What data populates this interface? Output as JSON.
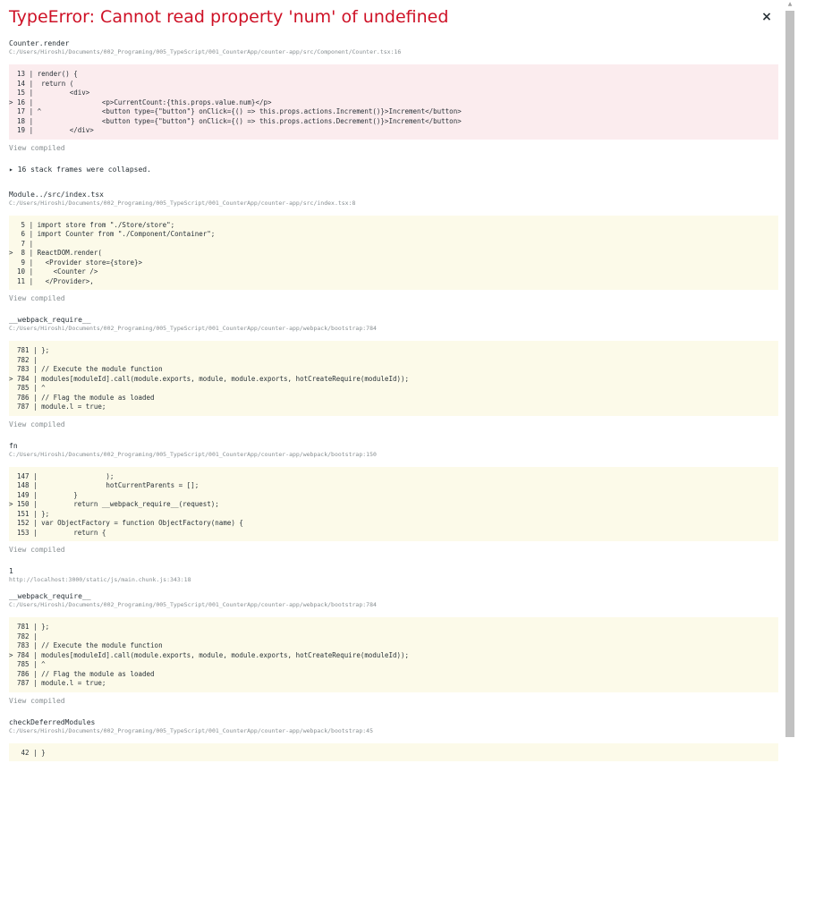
{
  "error": {
    "title": "TypeError: Cannot read property 'num' of undefined",
    "close_icon": "close-icon"
  },
  "view_compiled_label": "View compiled",
  "collapsed_label": "▸ 16 stack frames were collapsed.",
  "frames": [
    {
      "name": "Counter.render",
      "location": "C:/Users/Hiroshi/Documents/002_Programing/005_TypeScript/001_CounterApp/counter-app/src/Component/Counter.tsx:16",
      "lines": [
        "  13 | render() {",
        "  14 |  return (",
        "  15 |         <div>",
        "> 16 |                 <p>CurrentCount:{this.props.value.num}</p>",
        "  17 | ^               <button type={\"button\"} onClick={() => this.props.actions.Increment()}>Increment</button>",
        "  18 |                 <button type={\"button\"} onClick={() => this.props.actions.Decrement()}>Increment</button>",
        "  19 |         </div>"
      ]
    },
    {
      "name": "Module../src/index.tsx",
      "location": "C:/Users/Hiroshi/Documents/002_Programing/005_TypeScript/001_CounterApp/counter-app/src/index.tsx:8",
      "lines": [
        "   5 | import store from \"./Store/store\";",
        "   6 | import Counter from \"./Component/Container\";",
        "   7 |",
        ">  8 | ReactDOM.render(",
        "   9 |   <Provider store={store}>",
        "  10 |     <Counter />",
        "  11 |   </Provider>,"
      ]
    },
    {
      "name": "__webpack_require__",
      "location": "C:/Users/Hiroshi/Documents/002_Programing/005_TypeScript/001_CounterApp/counter-app/webpack/bootstrap:784",
      "lines": [
        "  781 | };",
        "  782 |",
        "  783 | // Execute the module function",
        "> 784 | modules[moduleId].call(module.exports, module, module.exports, hotCreateRequire(moduleId));",
        "  785 | ^",
        "  786 | // Flag the module as loaded",
        "  787 | module.l = true;"
      ]
    },
    {
      "name": "fn",
      "location": "C:/Users/Hiroshi/Documents/002_Programing/005_TypeScript/001_CounterApp/counter-app/webpack/bootstrap:150",
      "lines": [
        "  147 |                 );",
        "  148 |                 hotCurrentParents = [];",
        "  149 |         }",
        "> 150 |         return __webpack_require__(request);",
        "  151 | };",
        "  152 | var ObjectFactory = function ObjectFactory(name) {",
        "  153 |         return {"
      ]
    },
    {
      "name": "1",
      "location": "http://localhost:3000/static/js/main.chunk.js:343:18"
    },
    {
      "name": "__webpack_require__",
      "location": "C:/Users/Hiroshi/Documents/002_Programing/005_TypeScript/001_CounterApp/counter-app/webpack/bootstrap:784",
      "lines": [
        "  781 | };",
        "  782 |",
        "  783 | // Execute the module function",
        "> 784 | modules[moduleId].call(module.exports, module, module.exports, hotCreateRequire(moduleId));",
        "  785 | ^",
        "  786 | // Flag the module as loaded",
        "  787 | module.l = true;"
      ]
    },
    {
      "name": "checkDeferredModules",
      "location": "C:/Users/Hiroshi/Documents/002_Programing/005_TypeScript/001_CounterApp/counter-app/webpack/bootstrap:45",
      "lines": [
        "   42 | }"
      ]
    }
  ]
}
